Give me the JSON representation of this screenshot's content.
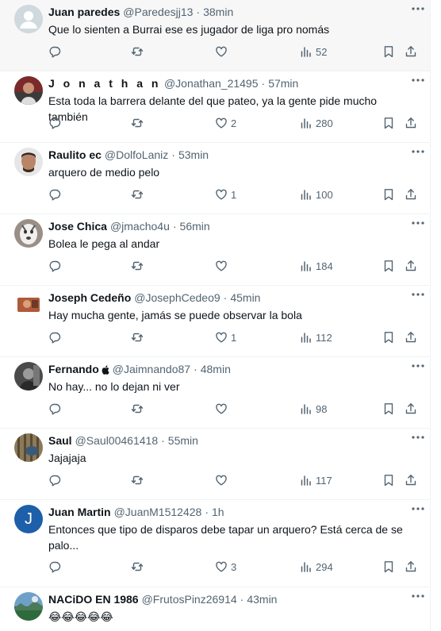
{
  "colors": {
    "text_primary": "#0f1419",
    "text_secondary": "#536471",
    "divider": "#eff3f4",
    "highlight_bg": "#f7f7f7",
    "default_avatar_bg": "#cfd9de",
    "letter_avatar_bg": "#1d5fa8"
  },
  "icons": {
    "reply": "reply-icon",
    "retweet": "retweet-icon",
    "like": "heart-icon",
    "views": "views-icon",
    "bookmark": "bookmark-icon",
    "share": "share-icon",
    "more": "more-icon",
    "verified_apple": "apple-icon"
  },
  "replies": [
    {
      "name": "Juan paredes",
      "handle": "@Paredesjj13",
      "separator": "·",
      "time": "38min",
      "text": "Que lo sienten a Burrai ese es jugador de liga pro nomás",
      "replies": "",
      "retweets": "",
      "likes": "",
      "views": "52"
    },
    {
      "name": "J o n a t h a n",
      "handle": "@Jonathan_21495",
      "separator": "·",
      "time": "57min",
      "text": "Esta toda la barrera delante del que pateo, ya la gente pide mucho también",
      "replies": "",
      "retweets": "",
      "likes": "2",
      "views": "280"
    },
    {
      "name": "Raulito ec",
      "handle": "@DolfoLaniz",
      "separator": "·",
      "time": "53min",
      "text": "arquero de medio pelo",
      "replies": "",
      "retweets": "",
      "likes": "1",
      "views": "100"
    },
    {
      "name": "Jose Chica",
      "handle": "@jmacho4u",
      "separator": "·",
      "time": "56min",
      "text": "Bolea le pega al andar",
      "replies": "",
      "retweets": "",
      "likes": "",
      "views": "184"
    },
    {
      "name": "Joseph Cedeño",
      "handle": "@JosephCedeo9",
      "separator": "·",
      "time": "45min",
      "text": "Hay mucha gente, jamás se puede observar la bola",
      "replies": "",
      "retweets": "",
      "likes": "1",
      "views": "112"
    },
    {
      "name": "Fernando",
      "handle": "@Jaimnando87",
      "separator": "·",
      "time": "48min",
      "text": "No hay... no lo dejan ni ver",
      "replies": "",
      "retweets": "",
      "likes": "",
      "views": "98"
    },
    {
      "name": "Saul",
      "handle": "@Saul00461418",
      "separator": "·",
      "time": "55min",
      "text": "Jajajaja",
      "replies": "",
      "retweets": "",
      "likes": "",
      "views": "117"
    },
    {
      "name": "Juan Martin",
      "handle": "@JuanM1512428",
      "separator": "·",
      "time": "1h",
      "avatar_letter": "J",
      "text": "Entonces que tipo de disparos debe tapar un arquero?  Está cerca de se palo...",
      "replies": "",
      "retweets": "",
      "likes": "3",
      "views": "294"
    },
    {
      "name": "NACiDO EN 1986",
      "handle": "@FrutosPinz26914",
      "separator": "·",
      "time": "43min",
      "text": "😂😂😂😂😂",
      "replies": "",
      "retweets": "",
      "likes": "",
      "views": ""
    }
  ]
}
